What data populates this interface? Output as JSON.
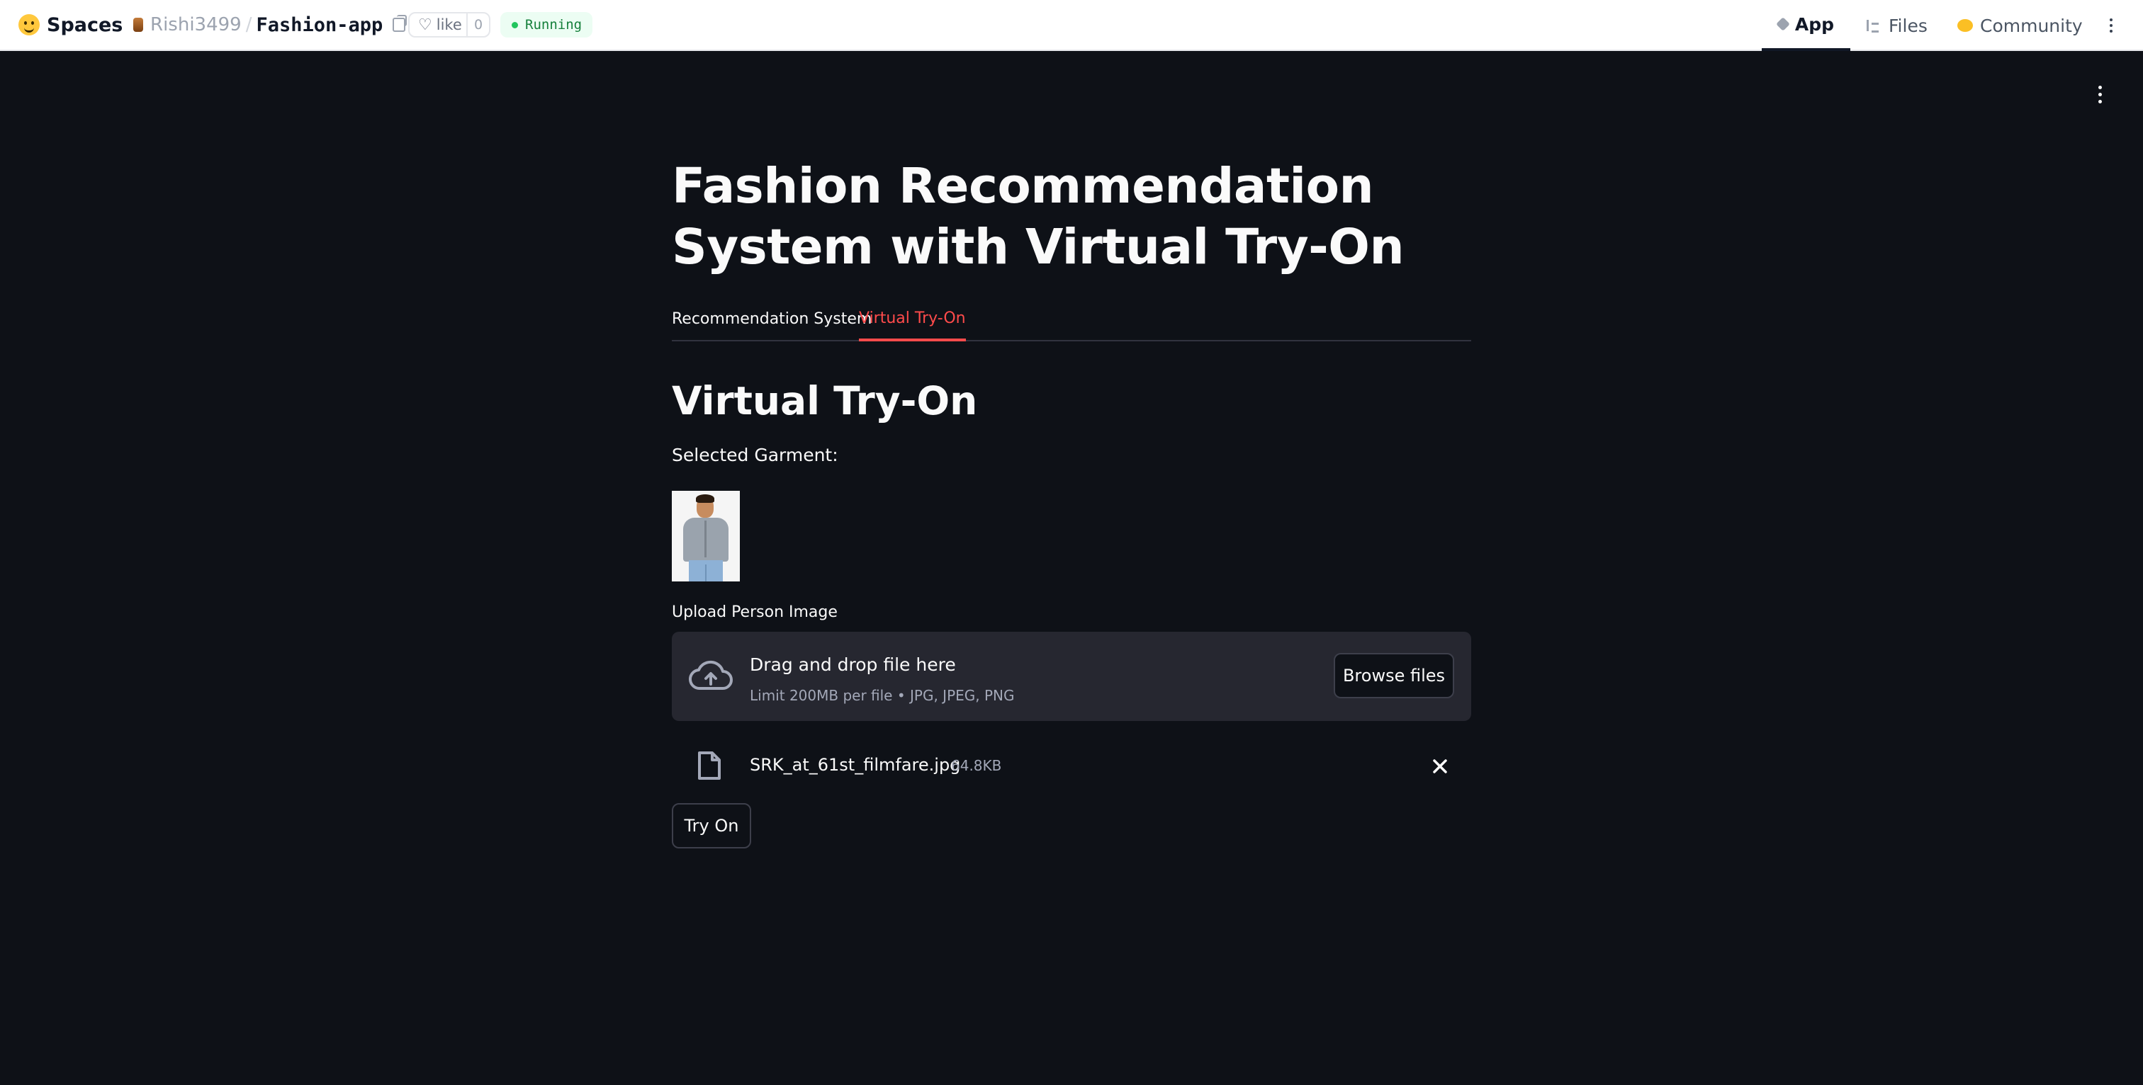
{
  "topbar": {
    "brand": "Spaces",
    "owner": "Rishi3499",
    "separator": "/",
    "space_name": "Fashion-app",
    "like_label": "like",
    "like_count": "0",
    "status": "Running",
    "nav": {
      "app": "App",
      "files": "Files",
      "community": "Community"
    }
  },
  "app": {
    "title": "Fashion Recommendation System with Virtual Try-On",
    "tabs": [
      {
        "label": "Recommendation System",
        "active": false
      },
      {
        "label": "Virtual Try-On",
        "active": true
      }
    ],
    "section_heading": "Virtual Try-On",
    "garment_label": "Selected Garment:",
    "uploader": {
      "label": "Upload Person Image",
      "drop_text": "Drag and drop file here",
      "limit_text": "Limit 200MB per file • JPG, JPEG, PNG",
      "browse_label": "Browse files"
    },
    "uploaded_file": {
      "name": "SRK_at_61st_filmfare.jpg",
      "size": "64.8KB"
    },
    "tryon_label": "Try On"
  },
  "colors": {
    "app_background": "#0e1117",
    "accent": "#ff4b4b",
    "dropzone": "#262730",
    "status_green": "#16803c"
  },
  "icons": [
    "hugging-face-icon",
    "copy-icon",
    "heart-icon",
    "cube-icon",
    "files-icon",
    "community-icon",
    "kebab-menu-icon",
    "cloud-upload-icon",
    "file-icon",
    "close-icon"
  ]
}
